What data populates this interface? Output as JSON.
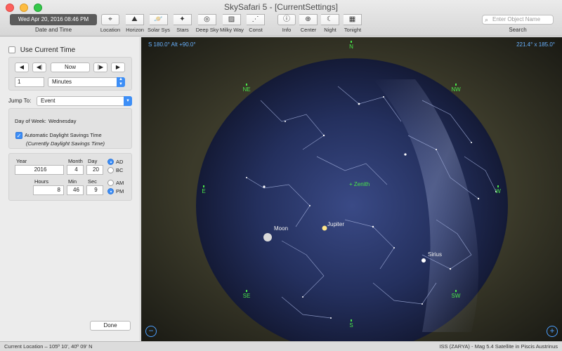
{
  "window": {
    "title": "SkySafari 5 - [CurrentSettings]"
  },
  "toolbar": {
    "datetime_value": "Wed Apr 20, 2016  08:46 PM",
    "datetime_label": "Date and Time",
    "tools": [
      {
        "label": "Location",
        "icon": "location-pin-icon"
      },
      {
        "label": "Horizon",
        "icon": "horizon-icon"
      },
      {
        "label": "Solar Sys",
        "icon": "planet-ring-icon"
      },
      {
        "label": "Stars",
        "icon": "stars-icon"
      },
      {
        "label": "Deep Sky",
        "icon": "galaxy-icon"
      },
      {
        "label": "Milky Way",
        "icon": "milky-way-icon"
      },
      {
        "label": "Const",
        "icon": "constellation-icon"
      },
      {
        "label": "Info",
        "icon": "info-icon"
      },
      {
        "label": "Center",
        "icon": "center-target-icon"
      },
      {
        "label": "Night",
        "icon": "night-moon-icon"
      },
      {
        "label": "Tonight",
        "icon": "calendar-icon"
      }
    ],
    "search_placeholder": "Enter Object Name",
    "search_label": "Search"
  },
  "panel": {
    "use_current_time": "Use Current Time",
    "nav": {
      "rewind": "◀",
      "step_back": "◀|",
      "now": "Now",
      "step_fwd": "|▶",
      "play": "▶"
    },
    "step_amount": "1",
    "step_unit": "Minutes",
    "jump_label": "Jump To:",
    "jump_value": "Event",
    "day_of_week_label": "Day of Week:",
    "day_of_week": "Wednesday",
    "dst_label": "Automatic Daylight Savings Time",
    "dst_note": "(Currently Daylight Savings Time)",
    "year_label": "Year",
    "year": "2016",
    "month_label": "Month",
    "month": "4",
    "day_label": "Day",
    "day": "20",
    "hours_label": "Hours",
    "hours": "8",
    "min_label": "Min",
    "min": "46",
    "sec_label": "Sec",
    "sec": "9",
    "era": [
      "AD",
      "BC"
    ],
    "era_selected": "AD",
    "ampm": [
      "AM",
      "PM"
    ],
    "ampm_selected": "PM",
    "done": "Done"
  },
  "sky": {
    "hud_left": "S 180.0° Alt +90.0°",
    "hud_right": "221.4° x 185.0°",
    "directions": {
      "n": "N",
      "ne": "NE",
      "nw": "NW",
      "e": "E",
      "w": "W",
      "se": "SE",
      "sw": "SW",
      "s": "S"
    },
    "objects": {
      "zenith": "Zenith",
      "jupiter": "Jupiter",
      "moon": "Moon",
      "sirius": "Sirius"
    },
    "zoom_out": "−",
    "zoom_in": "+"
  },
  "status": {
    "left": "Current Location – 105º 10', 40º 09' N",
    "right": "ISS (ZARYA) - Mag 5.4 Satellite in Piscis Austrinus"
  },
  "colors": {
    "accent": "#3d8ef6",
    "hud": "#69b2ff",
    "direction": "#49e64a"
  }
}
